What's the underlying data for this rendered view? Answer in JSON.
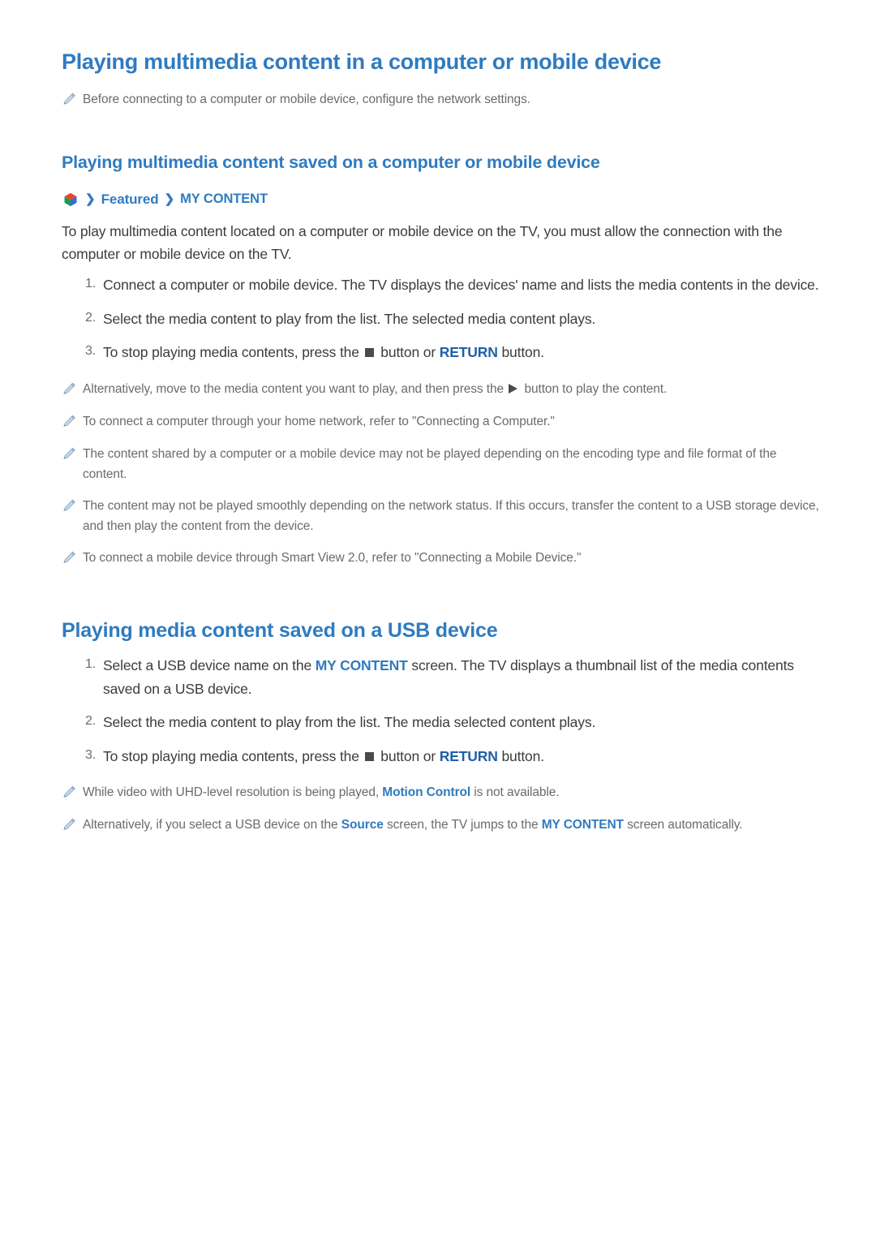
{
  "page": {
    "title": "Playing multimedia content in a computer or mobile device",
    "intro_note": "Before connecting to a computer or mobile device, configure the network settings.",
    "section1": {
      "heading": "Playing multimedia content saved on a computer or mobile device",
      "breadcrumb": {
        "icon": "smart-hub-icon",
        "separator": "❯",
        "items": [
          "Featured",
          "MY CONTENT"
        ]
      },
      "paragraph": "To play multimedia content located on a computer or mobile device on the TV, you must allow the connection with the computer or mobile device on the TV.",
      "steps": [
        {
          "num": "1.",
          "text": "Connect a computer or mobile device. The TV displays the devices' name and lists the media contents in the device."
        },
        {
          "num": "2.",
          "text": "Select the media content to play from the list. The selected media content plays."
        },
        {
          "num": "3.",
          "prefix": "To stop playing media contents, press the",
          "icon": "stop-button-icon",
          "middle": "button or",
          "keyword": "RETURN",
          "suffix": "button."
        }
      ],
      "notes": [
        {
          "prefix": "Alternatively, move to the media content you want to play, and then press the",
          "icon": "play-button-icon",
          "suffix": "button to play the content."
        },
        {
          "text": "To connect a computer through your home network, refer to \"Connecting a Computer.\""
        },
        {
          "text": "The content shared by a computer or a mobile device may not be played depending on the encoding type and file format of the content."
        },
        {
          "text": "The content may not be played smoothly depending on the network status. If this occurs, transfer the content to a USB storage device, and then play the content from the device."
        },
        {
          "text": "To connect a mobile device through Smart View 2.0, refer to \"Connecting a Mobile Device.\""
        }
      ]
    },
    "section2": {
      "heading": "Playing media content saved on a USB device",
      "steps": [
        {
          "num": "1.",
          "prefix": "Select a USB device name on the",
          "keyword": "MY CONTENT",
          "suffix": "screen. The TV displays a thumbnail list of the media contents saved on a USB device."
        },
        {
          "num": "2.",
          "text": "Select the media content to play from the list. The media selected content plays."
        },
        {
          "num": "3.",
          "prefix": "To stop playing media contents, press the",
          "icon": "stop-button-icon",
          "middle": "button or",
          "keyword": "RETURN",
          "suffix": "button."
        }
      ],
      "notes": [
        {
          "prefix": "While video with UHD-level resolution is being played,",
          "keyword": "Motion Control",
          "suffix": "is not available."
        },
        {
          "prefix": "Alternatively, if you select a USB device on the",
          "keyword": "Source",
          "middle": "screen, the TV jumps to the",
          "keyword2": "MY CONTENT",
          "suffix": "screen automatically."
        }
      ]
    },
    "colors": {
      "heading_blue": "#2f7bbf",
      "keyword_blue": "#1f5fa8",
      "body_text": "#3c3c3c",
      "note_text": "#6b6b6b"
    }
  }
}
